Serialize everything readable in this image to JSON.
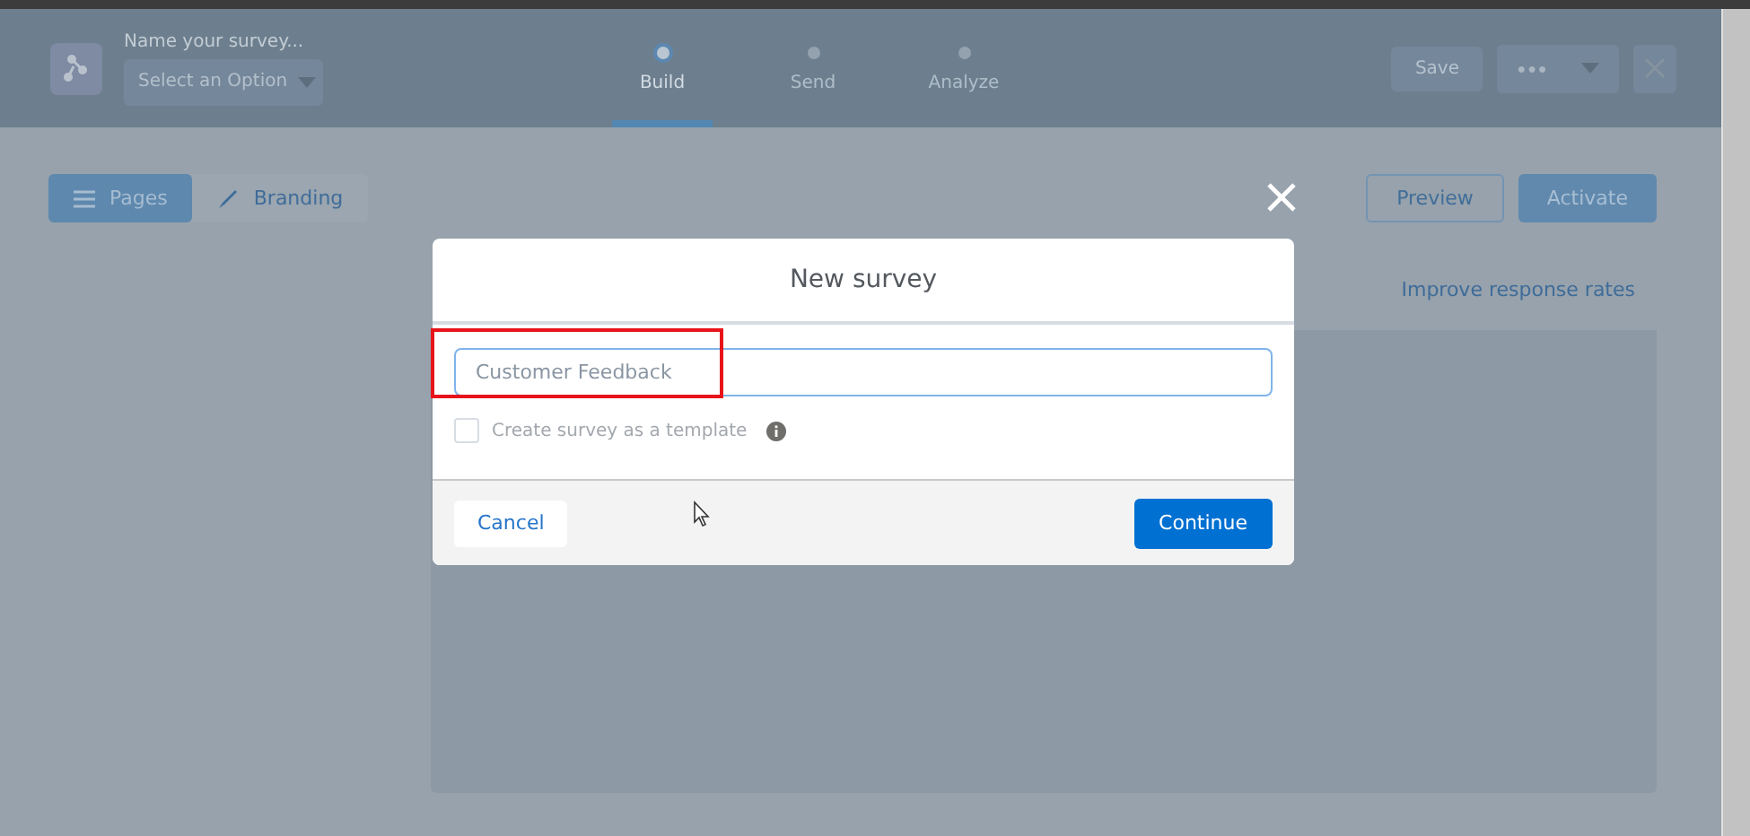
{
  "header": {
    "survey_name_placeholder": "Name your survey...",
    "select_placeholder": "Select an Option",
    "steps": [
      {
        "label": "Build",
        "selected": true
      },
      {
        "label": "Send",
        "selected": false
      },
      {
        "label": "Analyze",
        "selected": false
      }
    ],
    "save_button": "Save",
    "more_button": "●●●"
  },
  "toolbar": {
    "tabs": [
      {
        "label": "Pages",
        "selected": true
      },
      {
        "label": "Branding",
        "selected": false
      }
    ],
    "preview_button": "Preview",
    "activate_button": "Activate"
  },
  "banner_link": "Improve response rates",
  "modal": {
    "title": "New survey",
    "name_field": {
      "value": "Customer Feedback"
    },
    "template_checkbox": {
      "label": "Create survey as a template",
      "checked": false
    },
    "cancel_button": "Cancel",
    "continue_button": "Continue"
  }
}
